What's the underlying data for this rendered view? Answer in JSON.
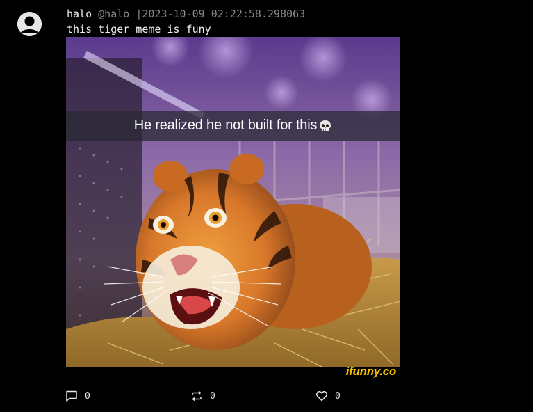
{
  "post": {
    "display_name": "halo",
    "handle": "@halo",
    "separator": "|",
    "timestamp": "2023-10-09 02:22:58.298063",
    "text": "this tiger meme is funy"
  },
  "media": {
    "caption": "He realized he not built for this",
    "caption_emoji": "skull-icon",
    "watermark": "ifunny.co"
  },
  "actions": {
    "reply": {
      "icon": "comment-icon",
      "count": "0"
    },
    "repost": {
      "icon": "repost-icon",
      "count": "0"
    },
    "like": {
      "icon": "heart-icon",
      "count": "0"
    }
  },
  "colors": {
    "background": "#000000",
    "text": "#e6e6e6",
    "muted": "#8a8a8a",
    "watermark": "#f2c200"
  }
}
